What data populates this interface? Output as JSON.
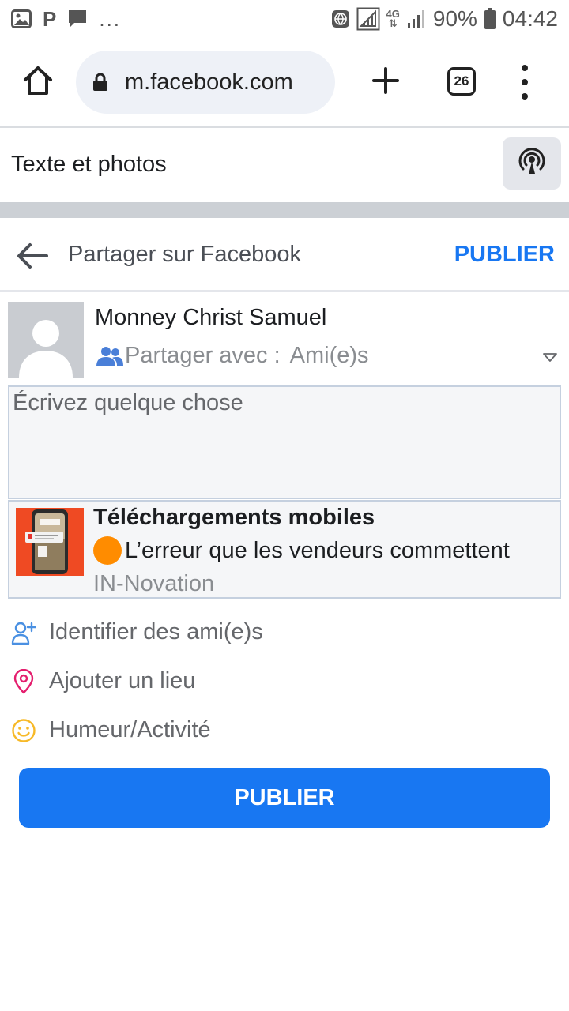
{
  "status_bar": {
    "notifications": [
      "image-icon",
      "p-icon",
      "chat-icon"
    ],
    "more": "...",
    "network": "4G",
    "battery": "90%",
    "time": "04:42"
  },
  "browser": {
    "url": "m.facebook.com",
    "tab_count": "26"
  },
  "app": {
    "title": "Texte et photos"
  },
  "share_header": {
    "title": "Partager sur Facebook",
    "publish_label": "PUBLIER"
  },
  "user": {
    "name": "Monney Christ Samuel",
    "share_with_label": "Partager avec :",
    "audience": "Ami(e)s"
  },
  "composer": {
    "placeholder": "Écrivez quelque chose",
    "value": ""
  },
  "link_preview": {
    "title": "Téléchargements mobiles",
    "description": "L’erreur que les vendeurs commettent",
    "source": "IN-Novation"
  },
  "actions": [
    {
      "label": "Identifier des ami(e)s",
      "icon": "tag-friend-icon"
    },
    {
      "label": "Ajouter un lieu",
      "icon": "location-pin-icon"
    },
    {
      "label": "Humeur/Activité",
      "icon": "smiley-icon"
    }
  ],
  "publish_button": {
    "label": "PUBLIER"
  },
  "colors": {
    "accent": "#1877f2",
    "location": "#e41e6e",
    "mood": "#f7b928"
  }
}
